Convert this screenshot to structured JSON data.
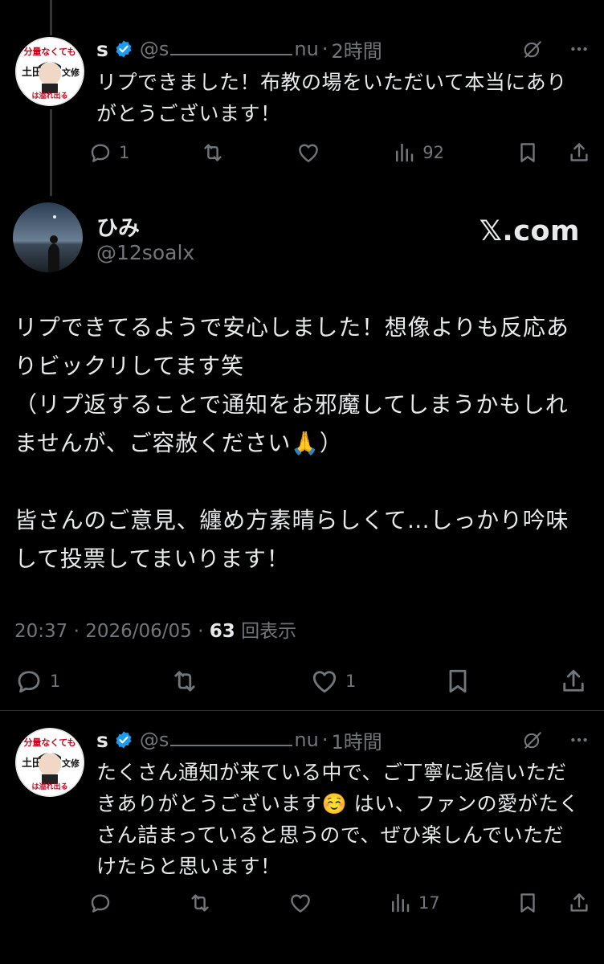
{
  "reply1": {
    "name": "s",
    "handle_prefix": "@s",
    "handle_suffix": "nu",
    "time": "2時間",
    "text": "リプできました！布教の場をいただいて本当にありがとうございます！",
    "replies": "1",
    "views": "92"
  },
  "main": {
    "name": "ひみ",
    "handle": "@12soalx",
    "brand": "𝕏.com",
    "text": "リプできてるようで安心しました！想像よりも反応ありビックリしてます笑\n（リプ返することで通知をお邪魔してしまうかもしれませんが、ご容赦ください🙏）\n\n皆さんのご意見、纏め方素晴らしくて…しっかり吟味して投票してまいります！",
    "time": "20:37",
    "date": "2026/06/05",
    "views_count": "63",
    "views_label": "回表示",
    "replies": "1",
    "likes": "1"
  },
  "reply2": {
    "name": "s",
    "handle_prefix": "@s",
    "handle_suffix": "nu",
    "time": "1時間",
    "text": "たくさん通知が来ている中で、ご丁寧に返信いただきありがとうございます☺️ はい、ファンの愛がたくさん詰まっていると思うので、ぜひ楽しんでいただけたらと思います！",
    "views": "17"
  },
  "avatar_badge": {
    "line1": "分量なくても",
    "line2": "土田",
    "line3": "文修",
    "line4": "は溢れ出る"
  },
  "colors": {
    "background": "#000000",
    "text": "#e7e9ea",
    "muted": "#71767b",
    "verified": "#1d9bf0"
  },
  "icons": [
    "reply-icon",
    "retweet-icon",
    "like-icon",
    "views-icon",
    "bookmark-icon",
    "share-icon",
    "grok-icon",
    "more-icon",
    "verified-badge-icon"
  ]
}
